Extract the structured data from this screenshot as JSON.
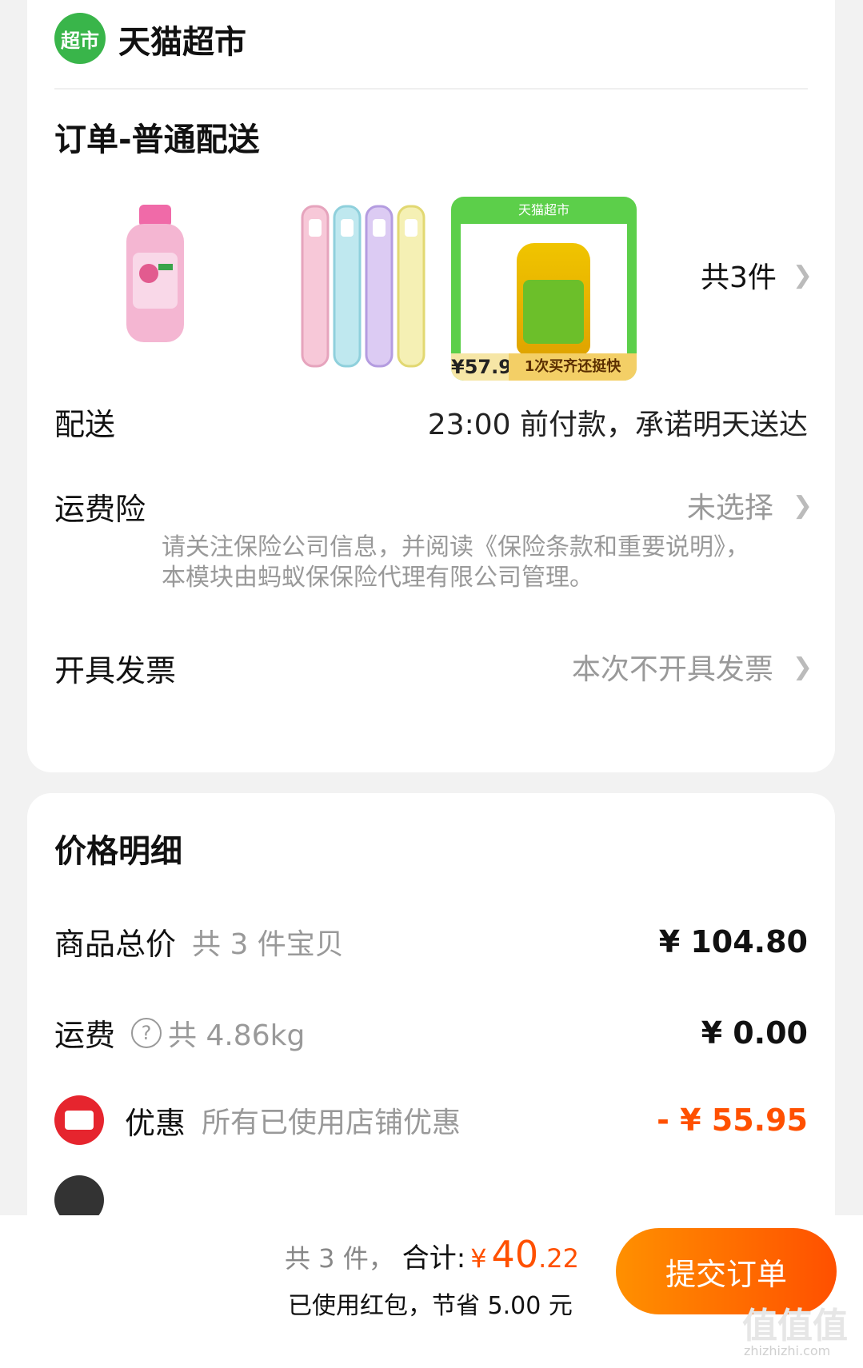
{
  "store": {
    "logo_text": "超市",
    "name": "天猫超市"
  },
  "order": {
    "title": "订单-普通配送",
    "products": [
      {
        "name": "mouthwash"
      },
      {
        "name": "toothbrush-set"
      },
      {
        "name": "cooking-oil",
        "badge_top": "天猫超市",
        "price": "¥57.9",
        "promo": "1次买齐还挺快"
      }
    ],
    "item_count": "共3件",
    "delivery": {
      "label": "配送",
      "value": "23:00 前付款，承诺明天送达"
    },
    "insurance": {
      "label": "运费险",
      "value": "未选择",
      "note": "请关注保险公司信息，并阅读《保险条款和重要说明》，本模块由蚂蚁保保险代理有限公司管理。"
    },
    "invoice": {
      "label": "开具发票",
      "value": "本次不开具发票"
    }
  },
  "price_detail": {
    "title": "价格明细",
    "goods": {
      "label": "商品总价",
      "sub": "共 3 件宝贝",
      "value": "¥ 104.80"
    },
    "freight": {
      "label": "运费",
      "sub": "共 4.86kg",
      "value": "¥ 0.00"
    },
    "discount": {
      "label": "优惠",
      "sub": "所有已使用店铺优惠",
      "value": "- ¥ 55.95"
    }
  },
  "bottom": {
    "count": "共 3 件，",
    "total_label": "合计:",
    "currency": "¥",
    "total_int": "40",
    "total_dec": ".22",
    "saved": "已使用红包，节省 5.00 元",
    "submit": "提交订单",
    "watermark": "值值值",
    "watermark_sub": "zhizhizhi.com"
  },
  "colors": {
    "accent": "#ff5000",
    "brand_green": "#39b54a",
    "coupon_red": "#e6252e"
  }
}
